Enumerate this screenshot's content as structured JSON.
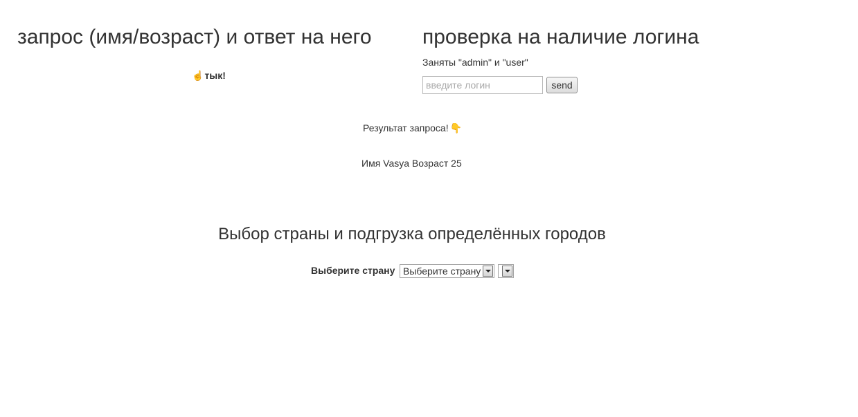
{
  "sections": {
    "request": {
      "title": "запрос (имя/возраст) и ответ на него",
      "trigger_icon": "☝",
      "trigger_label": "тык!"
    },
    "login_check": {
      "title": "проверка на наличие логина",
      "hint": "Заняты \"admin\" и \"user\"",
      "input_value": "",
      "input_placeholder": "введите логин",
      "send_label": "send"
    },
    "result": {
      "title": "Результат запроса!",
      "arrow_icon": "👇",
      "line": "Имя Vasya Возраст 25"
    },
    "country": {
      "title": "Выбор страны и подгрузка определённых городов",
      "label": "Выберите страну",
      "country_selected": "Выберите страну",
      "city_selected": ""
    }
  },
  "icons": {
    "trigger": "pointing-hand-icon",
    "result": "hand-down-icon",
    "dropdown": "chevron-down-icon"
  }
}
